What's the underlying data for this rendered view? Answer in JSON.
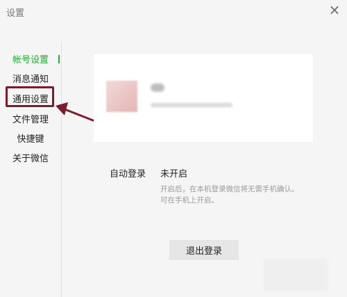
{
  "window": {
    "title": "设置",
    "close_symbol": "×"
  },
  "sidebar": {
    "items": [
      {
        "label": "帐号设置",
        "active": true
      },
      {
        "label": "消息通知",
        "active": false
      },
      {
        "label": "通用设置",
        "active": false,
        "highlighted": true
      },
      {
        "label": "文件管理",
        "active": false
      },
      {
        "label": "快捷键",
        "active": false
      },
      {
        "label": "关于微信",
        "active": false
      }
    ]
  },
  "account": {
    "auto_login_label": "自动登录",
    "auto_login_value": "未开启",
    "description_line1": "开启后，在本机登录微信将无需手机确认。",
    "description_line2": "可在手机上开启。",
    "logout_label": "退出登录"
  },
  "colors": {
    "accent": "#20b030",
    "annotation": "#7a1e2e",
    "background": "#f5f5f5",
    "button": "#e6e6e6"
  }
}
